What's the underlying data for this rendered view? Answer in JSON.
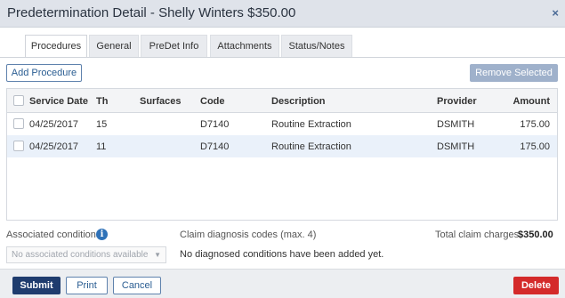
{
  "dialog": {
    "title": "Predetermination Detail - Shelly Winters $350.00",
    "close_glyph": "×"
  },
  "tabs": [
    {
      "label": "Procedures",
      "active": true
    },
    {
      "label": "General",
      "active": false
    },
    {
      "label": "PreDet Info",
      "active": false
    },
    {
      "label": "Attachments",
      "active": false
    },
    {
      "label": "Status/Notes",
      "active": false
    }
  ],
  "toolbar": {
    "add_label": "Add Procedure",
    "remove_label": "Remove Selected"
  },
  "table": {
    "columns": [
      "Service Date",
      "Th",
      "Surfaces",
      "Code",
      "Description",
      "Provider",
      "Amount"
    ],
    "rows": [
      {
        "date": "04/25/2017",
        "th": "15",
        "surfaces": "",
        "code": "D7140",
        "description": "Routine Extraction",
        "provider": "DSMITH",
        "amount": "175.00"
      },
      {
        "date": "04/25/2017",
        "th": "11",
        "surfaces": "",
        "code": "D7140",
        "description": "Routine Extraction",
        "provider": "DSMITH",
        "amount": "175.00"
      }
    ]
  },
  "conditions": {
    "label": "Associated conditions",
    "info_glyph": "i",
    "select_placeholder": "No associated conditions available",
    "caret": "▼"
  },
  "diagnosis": {
    "label": "Claim diagnosis codes (max. 4)",
    "empty_text": "No diagnosed conditions have been added yet."
  },
  "totals": {
    "label": "Total claim charges",
    "value": "$350.00"
  },
  "footer": {
    "submit_label": "Submit",
    "print_label": "Print",
    "cancel_label": "Cancel",
    "delete_label": "Delete"
  },
  "colors": {
    "primary": "#1f3c6e",
    "danger": "#d42a2a",
    "row_alt": "#eaf1fa",
    "info": "#2f72b8"
  }
}
